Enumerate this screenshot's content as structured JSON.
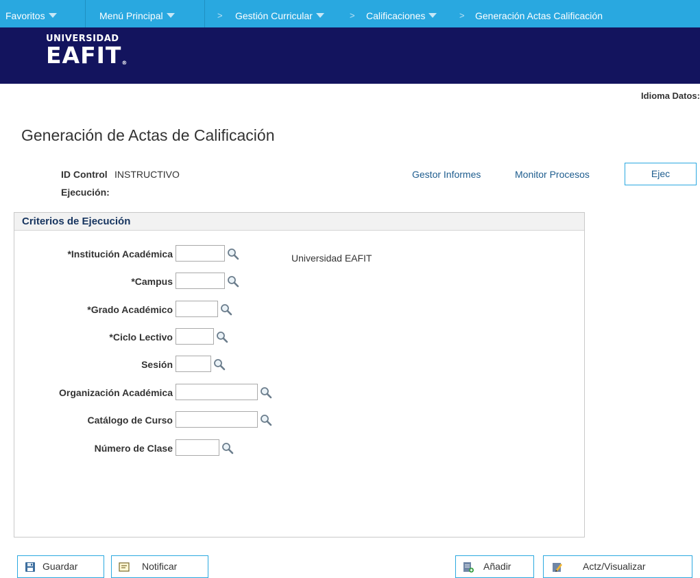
{
  "nav": {
    "favoritos": "Favoritos",
    "menu_principal": "Menú Principal",
    "breadcrumbs": [
      "Gestión Curricular",
      "Calificaciones",
      "Generación Actas Calificación"
    ]
  },
  "logo": {
    "line1": "UNIVERSIDAD",
    "line2": "EAFIT",
    "reg": "®"
  },
  "header": {
    "idioma": "Idioma Datos:"
  },
  "page": {
    "title": "Generación de Actas de Calificación",
    "run_control_label_1": "ID Control",
    "run_control_label_2": "Ejecución:",
    "run_control_value": "INSTRUCTIVO",
    "links": {
      "report_manager": "Gestor Informes",
      "process_monitor": "Monitor Procesos"
    },
    "run_button": "Ejec"
  },
  "criteria": {
    "heading": "Criterios de Ejecución",
    "fields": [
      {
        "label": "*Institución Académica",
        "value": "",
        "description": "Universidad EAFIT"
      },
      {
        "label": "*Campus",
        "value": ""
      },
      {
        "label": "*Grado Académico",
        "value": ""
      },
      {
        "label": "*Ciclo Lectivo",
        "value": ""
      },
      {
        "label": "Sesión",
        "value": ""
      },
      {
        "label": "Organización Académica",
        "value": ""
      },
      {
        "label": "Catálogo de Curso",
        "value": ""
      },
      {
        "label": "Número de Clase",
        "value": ""
      }
    ]
  },
  "footer": {
    "save": "Guardar",
    "notify": "Notificar",
    "add": "Añadir",
    "update_display": "Actz/Visualizar"
  },
  "colors": {
    "nav_bg": "#29a8e0",
    "banner_bg": "#13145e",
    "link": "#1d5c8e",
    "button_border": "#29a8e0"
  },
  "icons": [
    "caret-down-icon",
    "lookup-magnifier-icon",
    "save-disk-icon",
    "notify-note-icon",
    "add-page-icon",
    "update-pencil-icon"
  ]
}
